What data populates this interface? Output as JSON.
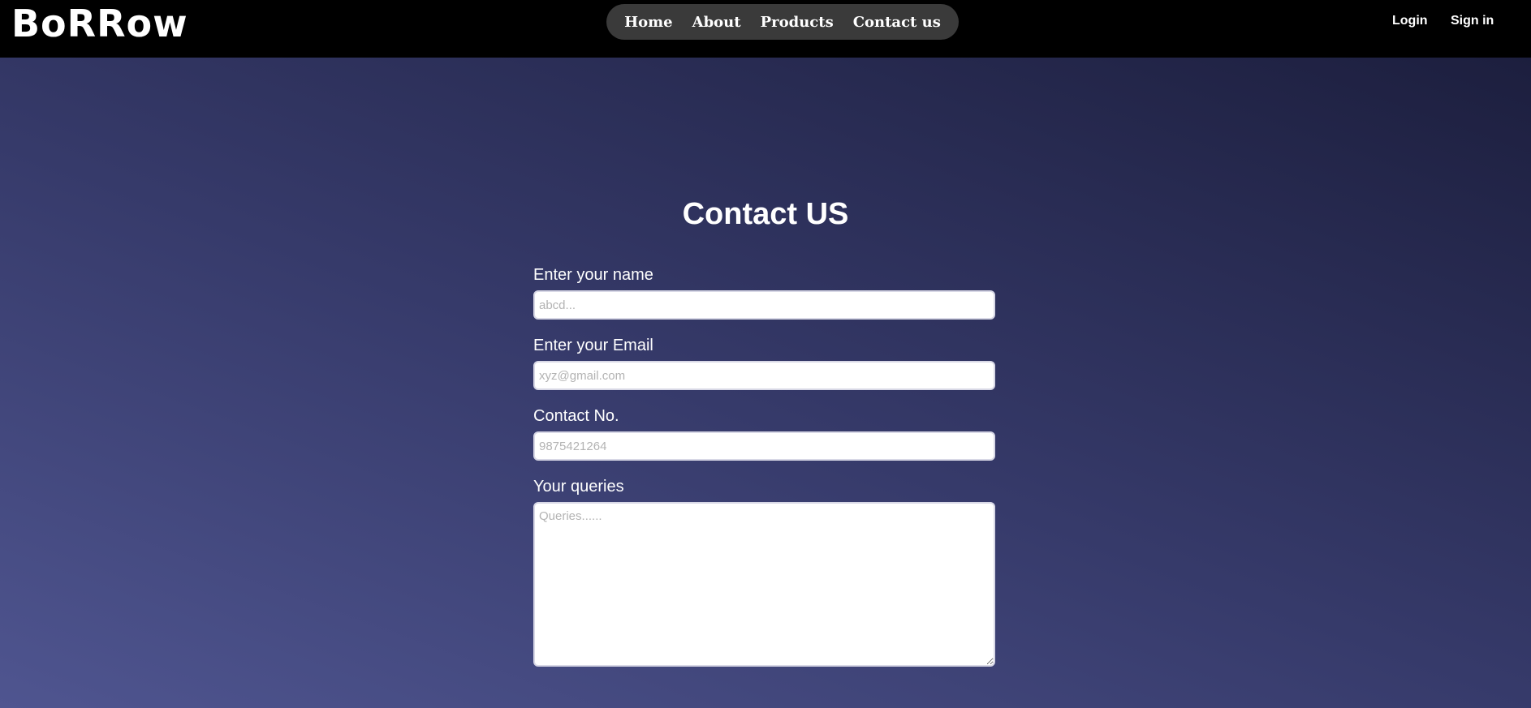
{
  "brand": {
    "logo_text": "BoRRow"
  },
  "nav": {
    "items": [
      {
        "label": "Home"
      },
      {
        "label": "About"
      },
      {
        "label": "Products"
      },
      {
        "label": "Contact us"
      }
    ]
  },
  "auth": {
    "login_label": "Login",
    "signin_label": "Sign in"
  },
  "page": {
    "title": "Contact US"
  },
  "form": {
    "name": {
      "label": "Enter your name",
      "placeholder": "abcd...",
      "value": ""
    },
    "email": {
      "label": "Enter your Email",
      "placeholder": "xyz@gmail.com",
      "value": ""
    },
    "contact": {
      "label": "Contact No.",
      "placeholder": "9875421264",
      "value": ""
    },
    "queries": {
      "label": "Your queries",
      "placeholder": "Queries......",
      "value": ""
    }
  },
  "colors": {
    "topbar": "#000000",
    "nav_pill": "#3a3a3a",
    "background_light": "#4f5590",
    "background_dark": "#1a1c3a"
  }
}
